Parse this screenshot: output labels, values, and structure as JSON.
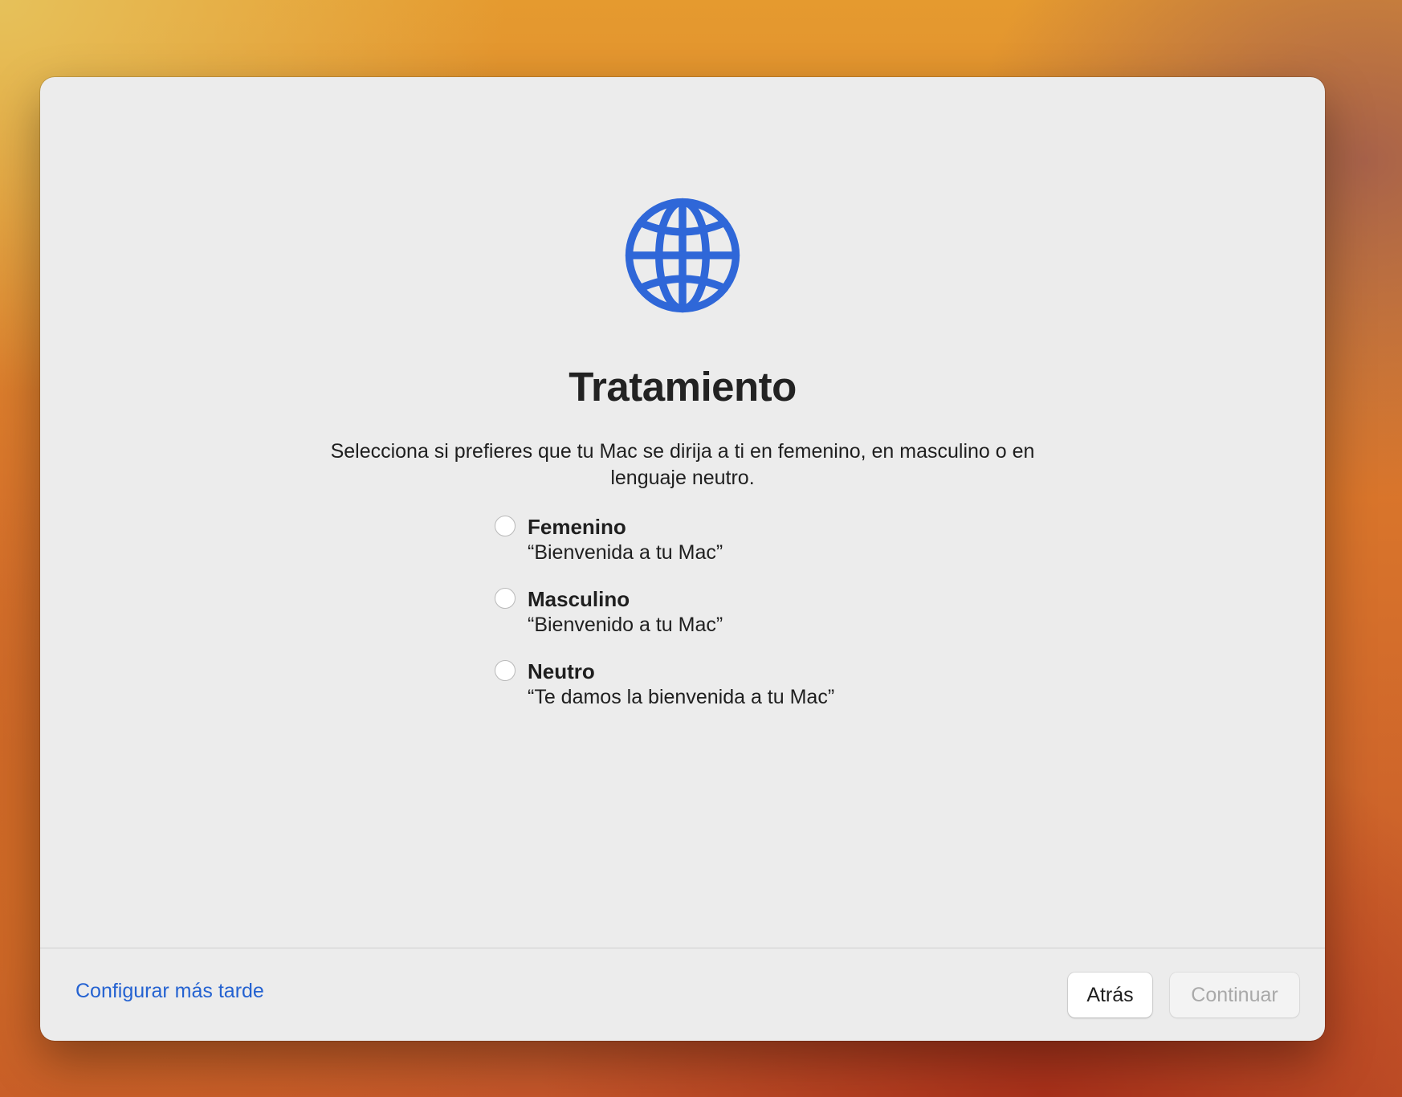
{
  "dialog": {
    "icon": "globe-icon",
    "accent_color": "#2f67d8",
    "title": "Tratamiento",
    "description": "Selecciona si prefieres que tu Mac se dirija a ti en femenino, en masculino o en lenguaje neutro."
  },
  "options": [
    {
      "label": "Femenino",
      "example": "“Bienvenida a tu Mac”",
      "selected": false
    },
    {
      "label": "Masculino",
      "example": "“Bienvenido a tu Mac”",
      "selected": false
    },
    {
      "label": "Neutro",
      "example": "“Te damos la bienvenida a tu Mac”",
      "selected": false
    }
  ],
  "footer": {
    "later_link": "Configurar más tarde",
    "back_button": "Atrás",
    "continue_button": "Continuar",
    "continue_enabled": false
  }
}
